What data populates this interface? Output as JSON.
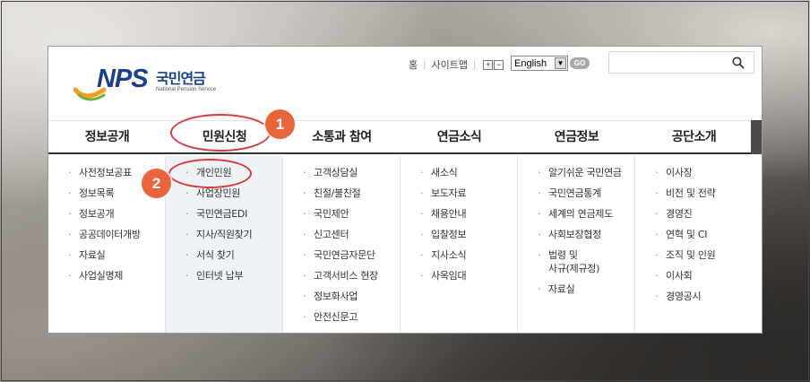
{
  "logo": {
    "nps": "NPS",
    "korean": "국민연금",
    "english": "National Pension Service"
  },
  "util": {
    "home": "홈",
    "sitemap": "사이트맵",
    "zoom_in": "+",
    "zoom_out": "−",
    "language_selected": "English",
    "go_label": "GO",
    "search_placeholder": ""
  },
  "gnb": [
    {
      "label": "정보공개",
      "active": false
    },
    {
      "label": "민원신청",
      "active": true
    },
    {
      "label": "소통과 참여",
      "active": false
    },
    {
      "label": "연금소식",
      "active": false
    },
    {
      "label": "연금정보",
      "active": false
    },
    {
      "label": "공단소개",
      "active": false
    }
  ],
  "submenus": [
    [
      "사전정보공표",
      "정보목록",
      "정보공개",
      "공공데이터개방",
      "자료실",
      "사업실명제"
    ],
    [
      "개인민원",
      "사업장민원",
      "국민연금EDI",
      "지사/직원찾기",
      "서식 찾기",
      "인터넷 납부"
    ],
    [
      "고객상담실",
      "친절/불친절",
      "국민제안",
      "신고센터",
      "국민연금자문단",
      "고객서비스 현장",
      "정보화사업",
      "안전신문고"
    ],
    [
      "새소식",
      "보도자료",
      "채용안내",
      "입찰정보",
      "지사소식",
      "사옥임대"
    ],
    [
      "알기쉬운 국민연금",
      "국민연금통계",
      "세계의 연금제도",
      "사회보장협정",
      "법령 및",
      "사규(제규정)",
      "자료실"
    ],
    [
      "이사장",
      "비전 및 전략",
      "경영진",
      "연혁 및 CI",
      "조직 및 인원",
      "이사회",
      "경영공시"
    ]
  ],
  "annotations": {
    "badge1": "1",
    "badge2": "2",
    "color": "#e8643a",
    "ring_color": "#d93a3a"
  },
  "colors": {
    "brand_blue": "#1a3f88",
    "active_column_bg": "#eef1f5"
  }
}
